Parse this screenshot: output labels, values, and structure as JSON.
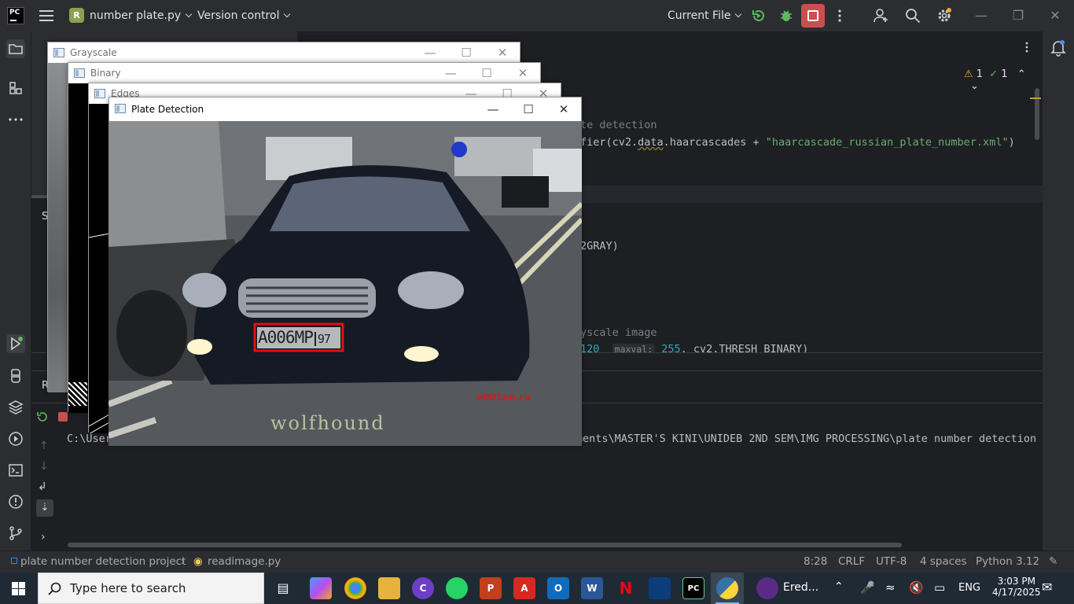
{
  "titlebar": {
    "app_logo": "PC",
    "project_initial": "R",
    "project_name": "number plate.py",
    "vcs_label": "Version control",
    "run_config": "Current File",
    "icons": [
      "hamburger-icon",
      "run-icon",
      "debug-icon",
      "stop-icon",
      "more-vert-icon",
      "add-user-icon",
      "search-icon",
      "settings-icon",
      "minimize-icon",
      "restore-icon",
      "close-icon"
    ]
  },
  "editor": {
    "inspection_warnings": "1",
    "inspection_ok": "1",
    "lines": [
      {
        "comment": "te detection"
      },
      {
        "code_prefix": "fier(cv2.",
        "code_data": "data",
        "code_mid": ".haarcascades + ",
        "string": "\"haarcascade_russian_plate_number.xml\"",
        "code_suffix": ")"
      },
      {
        "code": "2GRAY)"
      },
      {
        "comment": "yscale image"
      },
      {
        "num1": "120",
        "hint": "maxval:",
        "num2": "255",
        "code_suffix": ", cv2.THRESH_BINARY)"
      }
    ]
  },
  "run_panel": {
    "console_prefix": "C:\\User",
    "console_suffix": "ments\\MASTER'S KINI\\UNIDEB 2ND SEM\\IMG PROCESSING\\plate number detection",
    "side_labels": [
      "S",
      "R"
    ]
  },
  "cv_windows": [
    {
      "title": "Grayscale"
    },
    {
      "title": "Binary"
    },
    {
      "title": "Edges"
    },
    {
      "title": "Plate Detection"
    }
  ],
  "photo": {
    "plate_text": "A006MP",
    "plate_region": "97",
    "watermark": "wolfhound",
    "corner_text": "o001oo.ru"
  },
  "statusbar": {
    "breadcrumb_project": "plate number detection project",
    "breadcrumb_file": "readimage.py",
    "position": "8:28",
    "line_endings": "CRLF",
    "encoding": "UTF-8",
    "indent": "4 spaces",
    "interpreter": "Python 3.12"
  },
  "taskbar": {
    "search_placeholder": "Type here to search",
    "tray_app": "Ered...",
    "language": "ENG",
    "time": "3:03 PM",
    "date": "4/17/2025"
  },
  "colors": {
    "accent_red": "#c94f4f",
    "plate_box": "#e01010",
    "run_green": "#5fb85f"
  }
}
